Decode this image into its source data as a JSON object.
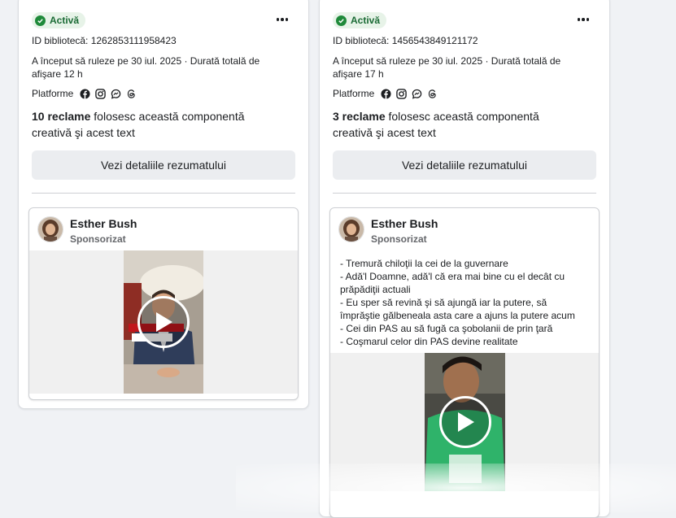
{
  "cards": [
    {
      "status": "Activă",
      "library_id": "ID bibliotecă: 1262853111958423",
      "started": "A început să ruleze pe 30 iul. 2025 · Durată totală de afişare 12 h",
      "platforms_label": "Platforme",
      "count_bold": "10 reclame",
      "count_rest": " folosesc această componentă creativă şi acest text",
      "button": "Vezi detaliile rezumatului",
      "ad": {
        "name": "Esther Bush",
        "sponsored": "Sponsorizat",
        "text": []
      }
    },
    {
      "status": "Activă",
      "library_id": "ID bibliotecă: 1456543849121172",
      "started": "A început să ruleze pe 30 iul. 2025 · Durată totală de afişare 17 h",
      "platforms_label": "Platforme",
      "count_bold": "3 reclame",
      "count_rest": " folosesc această componentă creativă şi acest text",
      "button": "Vezi detaliile rezumatului",
      "ad": {
        "name": "Esther Bush",
        "sponsored": "Sponsorizat",
        "text": [
          "- Tremură chiloţii la cei de la guvernare",
          "- Adă'l Doamne, adă'l că era mai bine cu el decât cu prăpădiţii actuali",
          "- Eu sper să revină şi să ajungă iar la putere, să împrăştie gălbeneala asta care a ajuns la putere acum",
          "- Cei din PAS au să fugă ca şobolanii de prin ţară",
          "- Coşmarul celor din PAS devine realitate"
        ]
      }
    }
  ],
  "icons": [
    "facebook-icon",
    "instagram-icon",
    "messenger-icon",
    "threads-icon"
  ],
  "colors": {
    "active_bg": "#e7f3e8",
    "active_text": "#1a6a34",
    "button_bg": "#ebedf0"
  }
}
